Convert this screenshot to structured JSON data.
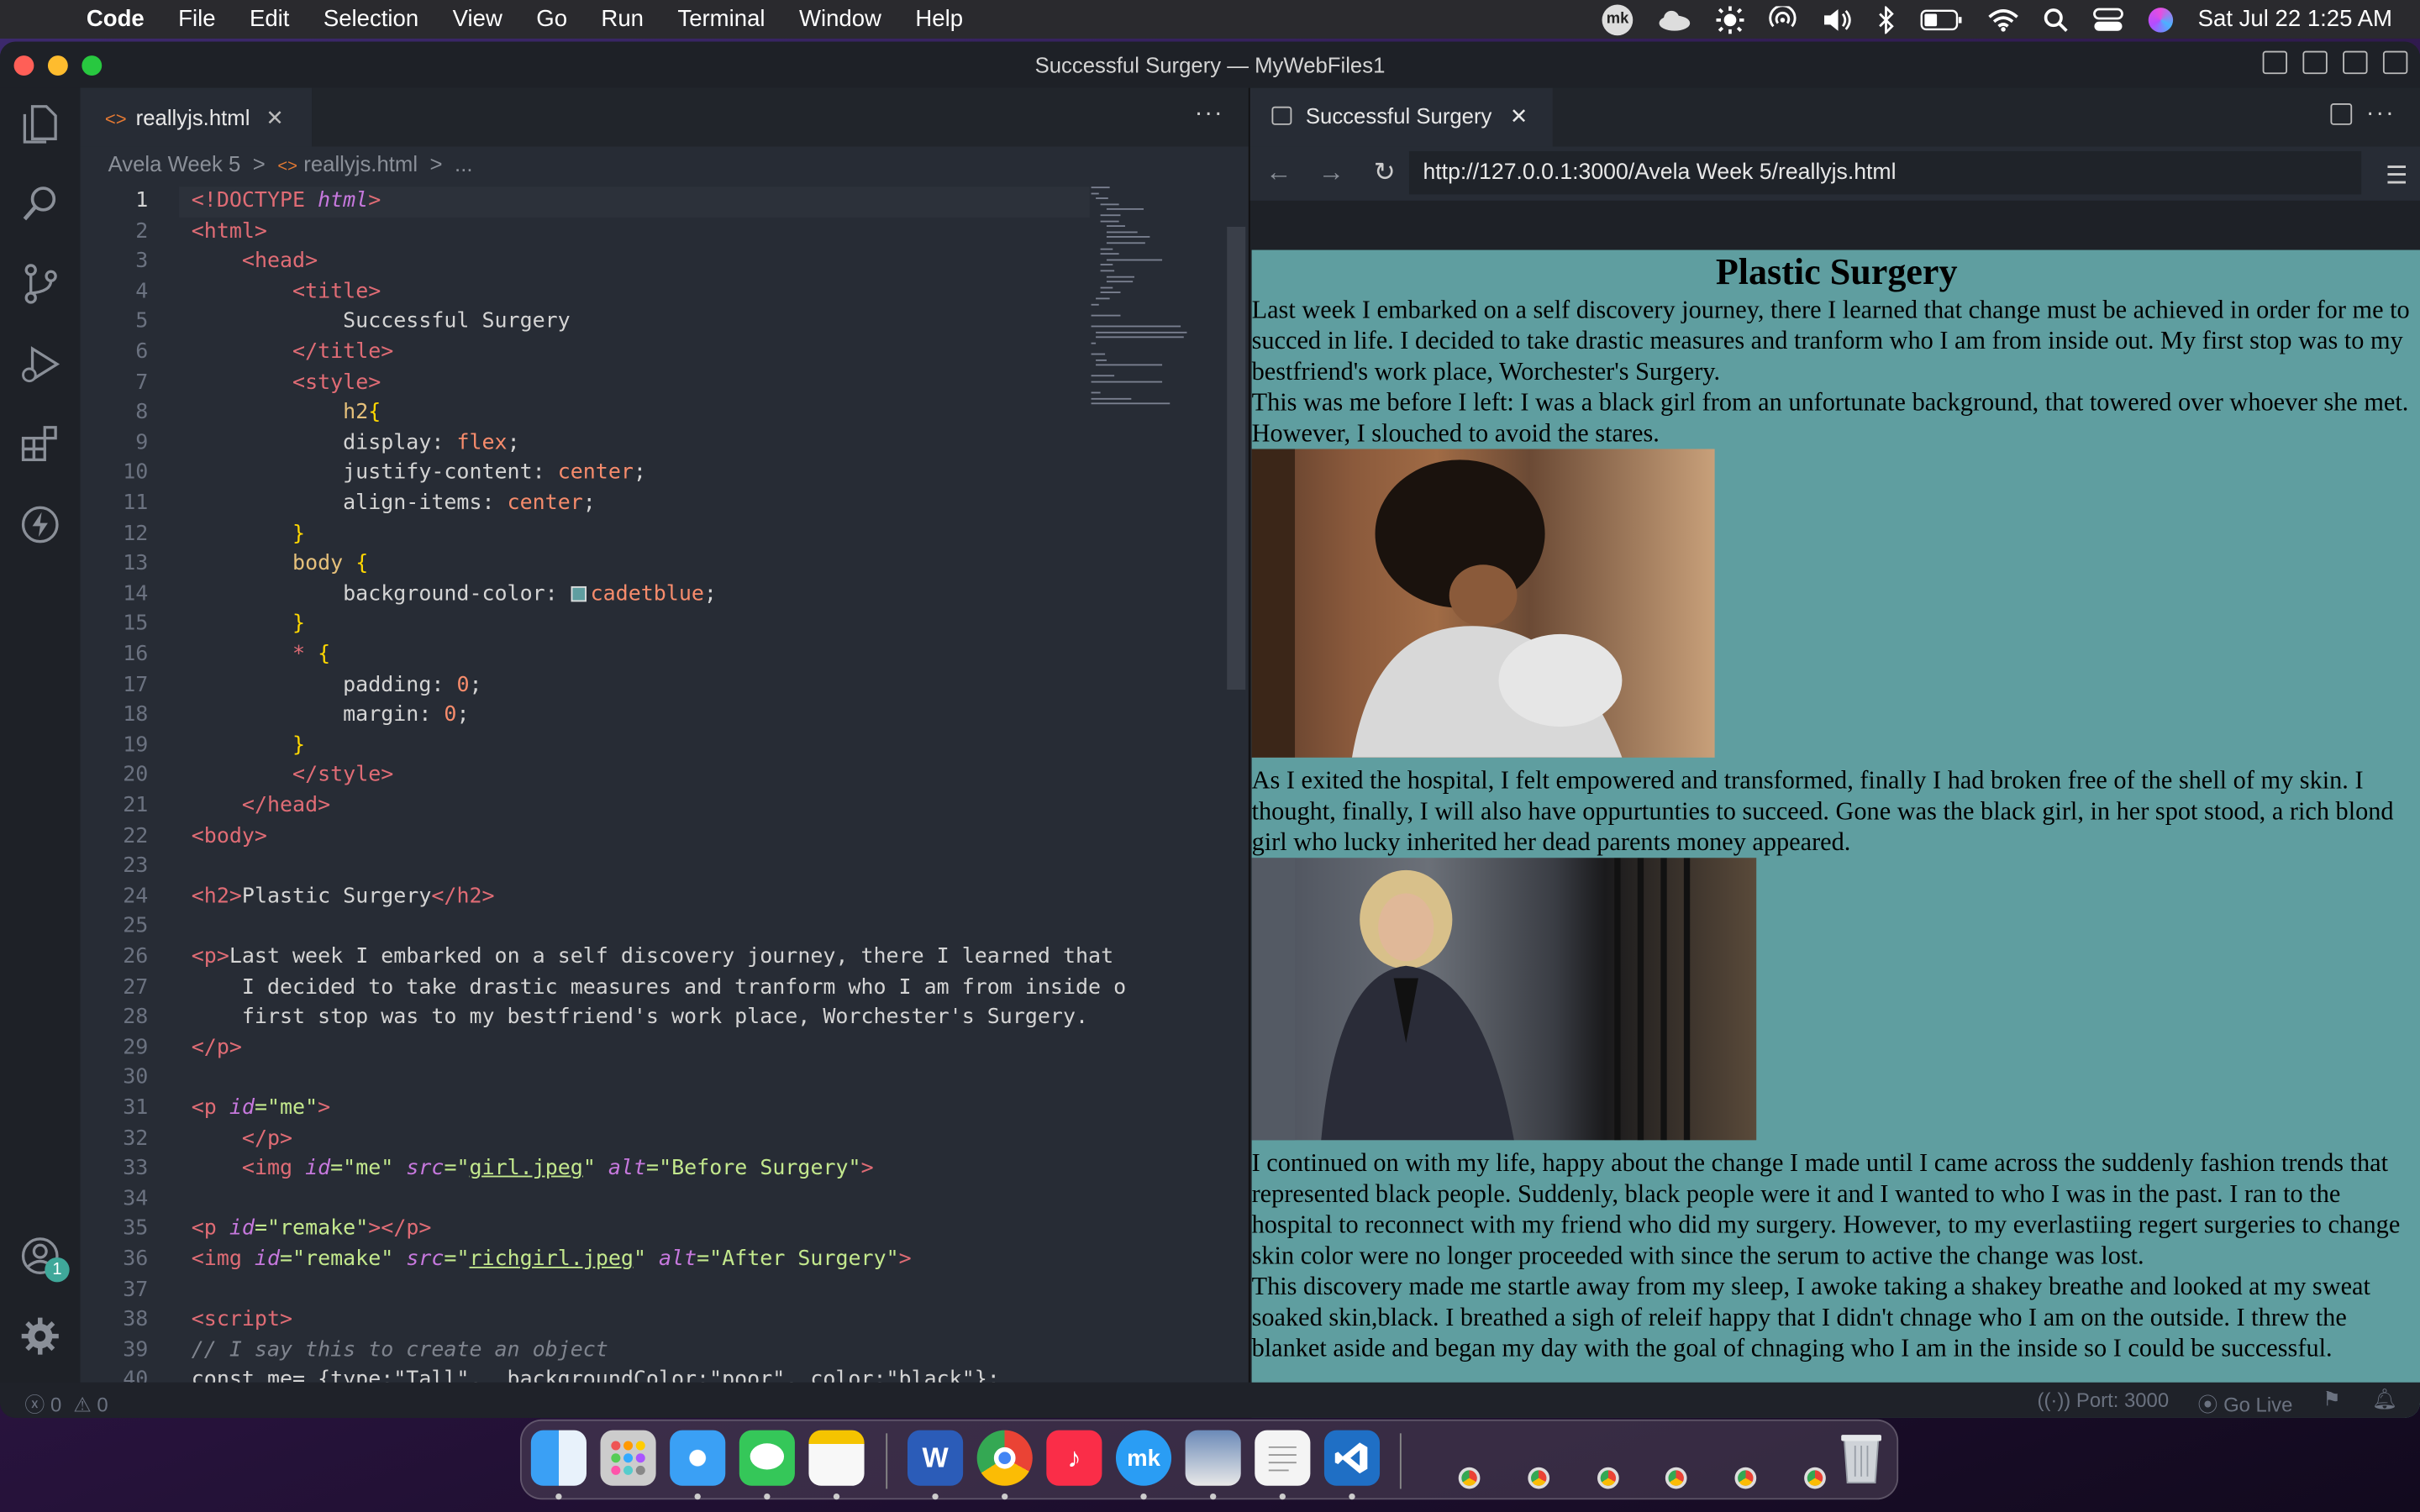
{
  "menubar": {
    "app": "Code",
    "items": [
      "File",
      "Edit",
      "Selection",
      "View",
      "Go",
      "Run",
      "Terminal",
      "Window",
      "Help"
    ],
    "clock": "Sat Jul 22  1:25 AM",
    "avatar_text": "mk"
  },
  "window": {
    "title": "Successful Surgery — MyWebFiles1"
  },
  "editor": {
    "tab_label": "reallyjs.html",
    "breadcrumb": [
      "Avela Week 5",
      ">",
      "reallyjs.html",
      ">",
      "..."
    ],
    "lines": [
      [
        [
          "<!DOCTYPE ",
          "t"
        ],
        [
          "html",
          "a"
        ],
        [
          ">",
          "t"
        ]
      ],
      [
        [
          "<html>",
          "t"
        ]
      ],
      [
        [
          "    "
        ],
        [
          "<head>",
          "t"
        ]
      ],
      [
        [
          "        "
        ],
        [
          "<title>",
          "t"
        ]
      ],
      [
        [
          "            Successful Surgery",
          "p"
        ]
      ],
      [
        [
          "        "
        ],
        [
          "</title>",
          "t"
        ]
      ],
      [
        [
          "        "
        ],
        [
          "<style>",
          "t"
        ]
      ],
      [
        [
          "            "
        ],
        [
          "h2",
          "n"
        ],
        [
          "{",
          "br"
        ]
      ],
      [
        [
          "            display: ",
          "p"
        ],
        [
          "flex",
          "v"
        ],
        [
          ";",
          "p"
        ]
      ],
      [
        [
          "            justify-content: ",
          "p"
        ],
        [
          "center",
          "v"
        ],
        [
          ";",
          "p"
        ]
      ],
      [
        [
          "            align-items: ",
          "p"
        ],
        [
          "center",
          "v"
        ],
        [
          ";",
          "p"
        ]
      ],
      [
        [
          "        "
        ],
        [
          "}",
          "br"
        ]
      ],
      [
        [
          "        "
        ],
        [
          "body",
          "n"
        ],
        [
          " "
        ],
        [
          "{",
          "br"
        ]
      ],
      [
        [
          "            background-color: ",
          "p"
        ],
        [
          "SWATCH",
          "sw"
        ],
        [
          "cadetblue",
          "v"
        ],
        [
          ";",
          "p"
        ]
      ],
      [
        [
          "        "
        ],
        [
          "}",
          "br"
        ]
      ],
      [
        [
          "        "
        ],
        [
          "*",
          "t"
        ],
        [
          " "
        ],
        [
          "{",
          "br"
        ]
      ],
      [
        [
          "            padding: ",
          "p"
        ],
        [
          "0",
          "v"
        ],
        [
          ";",
          "p"
        ]
      ],
      [
        [
          "            margin: ",
          "p"
        ],
        [
          "0",
          "v"
        ],
        [
          ";",
          "p"
        ]
      ],
      [
        [
          "        "
        ],
        [
          "}",
          "br"
        ]
      ],
      [
        [
          "        "
        ],
        [
          "</style>",
          "t"
        ]
      ],
      [
        [
          "    "
        ],
        [
          "</head>",
          "t"
        ]
      ],
      [
        [
          "<body>",
          "t"
        ]
      ],
      [
        [
          ""
        ]
      ],
      [
        [
          "<h2>",
          "t"
        ],
        [
          "Plastic Surgery",
          "p"
        ],
        [
          "</h2>",
          "t"
        ]
      ],
      [
        [
          ""
        ]
      ],
      [
        [
          "<p>",
          "t"
        ],
        [
          "Last week I embarked on a self discovery journey, there I learned that",
          "p"
        ]
      ],
      [
        [
          "    I decided to take drastic measures and tranform who I am from inside o",
          "p"
        ]
      ],
      [
        [
          "    first stop was to my bestfriend's work place, Worchester's Surgery.",
          "p"
        ]
      ],
      [
        [
          "</p>",
          "t"
        ]
      ],
      [
        [
          ""
        ]
      ],
      [
        [
          "<p ",
          "t"
        ],
        [
          "id",
          "a"
        ],
        [
          "=\"me\"",
          "s"
        ],
        [
          ">",
          "t"
        ]
      ],
      [
        [
          "    "
        ],
        [
          "</p>",
          "t"
        ]
      ],
      [
        [
          "    "
        ],
        [
          "<img ",
          "t"
        ],
        [
          "id",
          "a"
        ],
        [
          "=\"me\" ",
          "s"
        ],
        [
          "src",
          "a"
        ],
        [
          "=\"",
          "s"
        ],
        [
          "girl.jpeg",
          "su"
        ],
        [
          "\" ",
          "s"
        ],
        [
          "alt",
          "a"
        ],
        [
          "=\"Before Surgery\"",
          "s"
        ],
        [
          ">",
          "t"
        ]
      ],
      [
        [
          ""
        ]
      ],
      [
        [
          "<p ",
          "t"
        ],
        [
          "id",
          "a"
        ],
        [
          "=\"remake\"",
          "s"
        ],
        [
          "></p>",
          "t"
        ]
      ],
      [
        [
          "<img ",
          "t"
        ],
        [
          "id",
          "a"
        ],
        [
          "=\"remake\" ",
          "s"
        ],
        [
          "src",
          "a"
        ],
        [
          "=\"",
          "s"
        ],
        [
          "richgirl.jpeg",
          "su"
        ],
        [
          "\" ",
          "s"
        ],
        [
          "alt",
          "a"
        ],
        [
          "=\"After Surgery\"",
          "s"
        ],
        [
          ">",
          "t"
        ]
      ],
      [
        [
          ""
        ]
      ],
      [
        [
          "<script>",
          "t"
        ]
      ],
      [
        [
          "// I say this to create an object",
          "cm"
        ]
      ],
      [
        [
          "const me= {type:\"Tall\",  backgroundColor:\"poor\", color:\"black\"};",
          "p"
        ]
      ]
    ]
  },
  "preview": {
    "tab_label": "Successful Surgery",
    "url": "http://127.0.0.1:3000/Avela Week 5/reallyjs.html",
    "heading": "Plastic Surgery",
    "para1": "Last week I embarked on a self discovery journey, there I learned that change must be achieved in order for me to succed in life. I decided to take drastic measures and tranform who I am from inside out. My first stop was to my bestfriend's work place, Worchester's Surgery.",
    "para2": "This was me before I left: I was a black girl from an unfortunate background, that towered over whoever she met. However, I slouched to avoid the stares.",
    "para3": "As I exited the hospital, I felt empowered and transformed, finally I had broken free of the shell of my skin. I thought, finally, I will also have oppurtunties to succeed. Gone was the black girl, in her spot stood, a rich blond girl who lucky inherited her dead parents money appeared.",
    "para4": "I continued on with my life, happy about the change I made until I came across the suddenly fashion trends that represented black people. Suddenly, black people were it and I wanted to who I was in the past. I ran to the hospital to reconnect with my friend who did my surgery. However, to my everlastiing regert surgeries to change skin color were no longer proceeded with since the serum to active the change was lost.",
    "para5": "This discovery made me startle away from my sleep, I awoke taking a shakey breathe and looked at my sweat soaked skin,black. I breathed a sigh of releif happy that I didn't chnage who I am on the outside. I threw the blanket aside and began my day with the goal of chnaging who I am in the inside so I could be successful."
  },
  "statusbar": {
    "errors": "0",
    "warnings": "0",
    "port": "Port: 3000",
    "golive": "Go Live"
  },
  "dock": {
    "word": "W",
    "appstore": "mk"
  },
  "colors": {
    "cadetblue": "#5f9ea0",
    "editor_bg": "#272c35",
    "accent": "#3fa89a"
  }
}
